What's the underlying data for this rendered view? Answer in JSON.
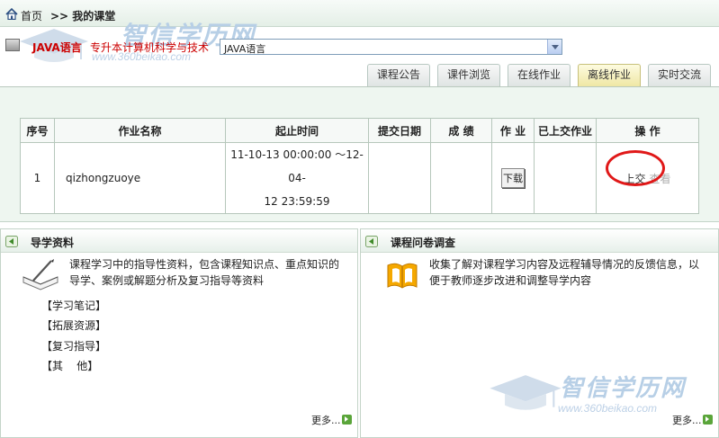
{
  "breadcrumb": {
    "home": "首页",
    "current": ">> 我的课堂"
  },
  "watermark": {
    "cn": "智信学历网",
    "en": "www.360beikao.com"
  },
  "course": {
    "name": "JAVA语言",
    "major": "专升本计算机科学与技术",
    "selected": "JAVA语言"
  },
  "tabs": [
    {
      "label": "课程公告",
      "active": false
    },
    {
      "label": "课件浏览",
      "active": false
    },
    {
      "label": "在线作业",
      "active": false
    },
    {
      "label": "离线作业",
      "active": true
    },
    {
      "label": "实时交流",
      "active": false
    }
  ],
  "homework_table": {
    "headers": [
      "序号",
      "作业名称",
      "起止时间",
      "提交日期",
      "成 绩",
      "作 业",
      "已上交作业",
      "操 作"
    ],
    "rows": [
      {
        "index": "1",
        "name": "qizhongzuoye",
        "time_line1": "11-10-13 00:00:00 ～12-04-",
        "time_line2": "12 23:59:59",
        "submit_date": "",
        "score": "",
        "download": "下载",
        "submitted": "",
        "submit": "上交",
        "view": "查看"
      }
    ]
  },
  "guide_panel": {
    "title": "导学资料",
    "desc_line1": "课程学习中的指导性资料，包含课程知识点、重点知识的",
    "desc_line2": "导学、案例或解题分析及复习指导等资料",
    "items": [
      "【学习笔记】",
      "【拓展资源】",
      "【复习指导】",
      "【其    他】"
    ],
    "more": "更多..."
  },
  "survey_panel": {
    "title": "课程问卷调查",
    "desc_line1": "收集了解对课程学习内容及远程辅导情况的反馈信息，以",
    "desc_line2": "便于教师逐步改进和调整导学内容",
    "more": "更多..."
  },
  "colors": {
    "course_red": "#cc0000",
    "highlight_circle": "#e01818",
    "active_tab": "#efe7a4"
  }
}
